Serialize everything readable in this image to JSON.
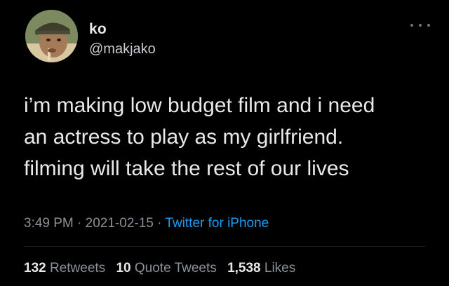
{
  "user": {
    "display_name": "ko",
    "handle": "@makjako"
  },
  "tweet": {
    "text": "i’m making low budget film and i need\nan actress to play as my girlfriend.\nfilming will take the rest of our lives",
    "time": "3:49 PM",
    "separator": "·",
    "date": "2021-02-15",
    "source": "Twitter for iPhone"
  },
  "stats": {
    "retweets_count": "132",
    "retweets_label": "Retweets",
    "quotes_count": "10",
    "quotes_label": "Quote Tweets",
    "likes_count": "1,538",
    "likes_label": "Likes"
  },
  "icons": {
    "more": "more-options-icon",
    "avatar": "avatar"
  },
  "colors": {
    "background": "#000000",
    "text": "#e7e9ea",
    "muted": "#8b9198",
    "link": "#1d9bf0"
  }
}
